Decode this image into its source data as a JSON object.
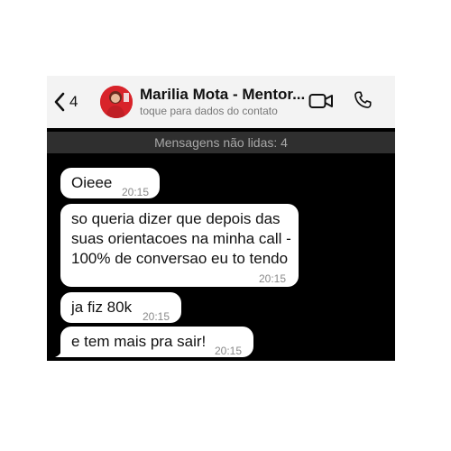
{
  "header": {
    "back_count": "4",
    "contact_name": "Marilia Mota - Mentor...",
    "contact_subtitle": "toque para dados do contato",
    "icons": [
      "chevron-left-icon",
      "video-camera-icon",
      "phone-icon"
    ]
  },
  "unread_banner": "Mensagens não lidas: 4",
  "messages": [
    {
      "text": "Oieee",
      "time": "20:15"
    },
    {
      "text": "so queria dizer que depois das suas orientacoes na minha call - 100% de conversao eu to tendo",
      "time": "20:15"
    },
    {
      "text": "ja fiz 80k",
      "time": "20:15"
    },
    {
      "text": "e tem mais pra sair!",
      "time": "20:15"
    }
  ],
  "colors": {
    "header_bg": "#f3f3f3",
    "chat_bg": "#000000",
    "banner_bg": "#2f2f2f",
    "bubble_bg": "#ffffff",
    "avatar_bg": "#d8232a"
  }
}
